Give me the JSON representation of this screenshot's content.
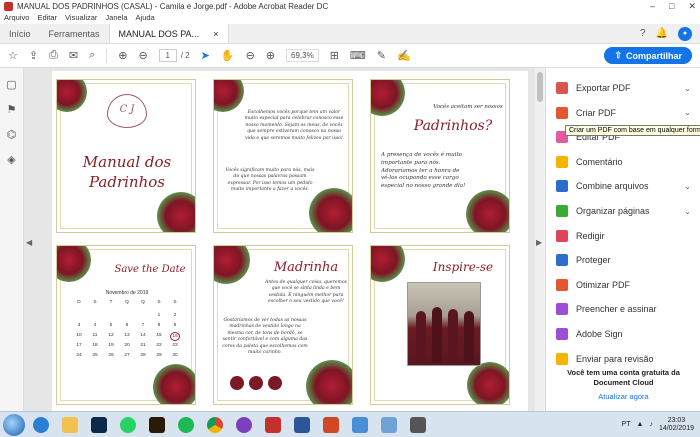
{
  "window": {
    "title": "MANUAL DOS PADRINHOS (CASAL) - Camila e Jorge.pdf - Adobe Acrobat Reader DC",
    "controls": [
      "–",
      "□",
      "✕"
    ]
  },
  "menu": [
    "Arquivo",
    "Editar",
    "Visualizar",
    "Janela",
    "Ajuda"
  ],
  "tabs": {
    "home": "Início",
    "tools": "Ferramentas",
    "document": "MANUAL DOS PA...",
    "close": "×"
  },
  "toolbar": {
    "page_current": "1",
    "page_total": "/ 2",
    "zoom": "69,3%",
    "share_label": "Compartilhar"
  },
  "cards": {
    "c1_title": "Manual dos Padrinhos",
    "c1_monogram": "C J",
    "c2_text1": "Escolhemos vocês porque tem um valor muito especial para celebrar conosco esse nosso momento. Sejam os meus, de vocês que sempre estiveram conosco na nossa vida e que seremos muito felizes por isso!",
    "c2_text2": "Vocês significam muito para nós, mais do que nossas palavras possam expressar. Por isso temos um pedido muito importante a fazer a vocês.",
    "c3_text1": "Vocês aceitam ser nossos",
    "c3_title": "Padrinhos?",
    "c3_text2": "A presença de vocês é muito importante para nós. Adoraríamos ter a honra de vê-los ocupando esse cargo especial no nosso grande dia!",
    "c4_title": "Save the Date",
    "c4_month": "Novembro de 2019",
    "c5_title": "Madrinha",
    "c5_text1": "Antes de qualquer coisa, queremos que você se sinta linda e bem vestida. É ninguém melhor para escolher o seu vestido que você!",
    "c5_text2": "Gostaríamos de ver todas as nossas madrinhas de vestido longo na mesma cor, de tons de bordô, se sentir confortável e com alguma das cores da paleta que escolhemos com muito carinho.",
    "c6_title": "Inspire-se"
  },
  "calendar": {
    "weekdays": [
      "D",
      "S",
      "T",
      "Q",
      "Q",
      "S",
      "S"
    ],
    "weeks": [
      [
        "",
        "",
        "",
        "",
        "",
        "1",
        "2"
      ],
      [
        "3",
        "4",
        "5",
        "6",
        "7",
        "8",
        "9"
      ],
      [
        "10",
        "11",
        "12",
        "13",
        "14",
        "15",
        "16"
      ],
      [
        "17",
        "18",
        "19",
        "20",
        "21",
        "22",
        "23"
      ],
      [
        "24",
        "25",
        "26",
        "27",
        "28",
        "29",
        "30"
      ]
    ],
    "highlight": "16"
  },
  "right_panel": {
    "items": [
      {
        "label": "Exportar PDF",
        "color": "#d9534f",
        "chev": true
      },
      {
        "label": "Criar PDF",
        "color": "#e4572e",
        "chev": true
      },
      {
        "label": "Editar PDF",
        "color": "#e25ba0",
        "chev": false
      },
      {
        "label": "Comentário",
        "color": "#f5b400",
        "chev": false
      },
      {
        "label": "Combine arquivos",
        "color": "#2d6ccf",
        "chev": true
      },
      {
        "label": "Organizar páginas",
        "color": "#3aaa35",
        "chev": true
      },
      {
        "label": "Redigir",
        "color": "#e0435b",
        "chev": false
      },
      {
        "label": "Proteger",
        "color": "#2d6ccf",
        "chev": false
      },
      {
        "label": "Otimizar PDF",
        "color": "#e4572e",
        "chev": false
      },
      {
        "label": "Preencher e assinar",
        "color": "#9c4fd6",
        "chev": false
      },
      {
        "label": "Adobe Sign",
        "color": "#9c4fd6",
        "chev": false
      },
      {
        "label": "Enviar para revisão",
        "color": "#f5b400",
        "chev": false
      }
    ],
    "tooltip": "Criar um PDF com base em qualquer formato",
    "promo_text": "Você tem uma conta gratuita da Document Cloud",
    "promo_link": "Atualizar agora"
  },
  "taskbar": {
    "lang": "PT",
    "time": "23:03",
    "date": "14/02/2019"
  }
}
